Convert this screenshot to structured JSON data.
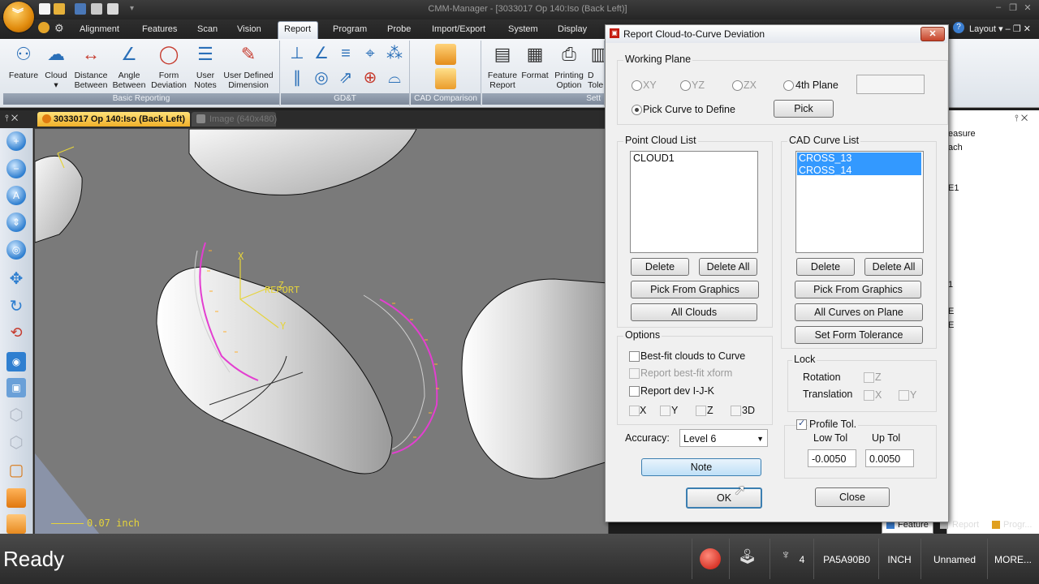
{
  "app": {
    "title": "CMM-Manager - [3033017 Op 140:Iso (Back Left)]",
    "layout_menu": "Layout",
    "window_min": "–",
    "window_restore": "❐",
    "window_close": "✕"
  },
  "tabs": [
    "Alignment",
    "Features",
    "Scan",
    "Vision",
    "Report",
    "Program",
    "Probe",
    "Import/Export",
    "System",
    "Display"
  ],
  "ribbon": {
    "basic_reporting": {
      "label": "Basic Reporting",
      "items": [
        {
          "line1": "Feature",
          "line2": ""
        },
        {
          "line1": "Cloud",
          "line2": "▾"
        },
        {
          "line1": "Distance",
          "line2": "Between"
        },
        {
          "line1": "Angle",
          "line2": "Between"
        },
        {
          "line1": "Form",
          "line2": "Deviation"
        },
        {
          "line1": "User",
          "line2": "Notes"
        },
        {
          "line1": "User Defined",
          "line2": "Dimension"
        }
      ]
    },
    "gdt": {
      "label": "GD&T"
    },
    "cad_comparison": {
      "label": "CAD Comparison"
    },
    "report_group": {
      "label": "Sett",
      "items": [
        {
          "line1": "Feature",
          "line2": "Report"
        },
        {
          "line1": "Format",
          "line2": ""
        },
        {
          "line1": "Printing",
          "line2": "Option"
        },
        {
          "line1": "D",
          "line2": "Tole"
        }
      ]
    }
  },
  "doc_tabs": {
    "active": "3033017 Op 140:Iso (Back Left)",
    "inactive": "Image (640x480)"
  },
  "viewport": {
    "report_label": "REPORT",
    "axis_x": "X",
    "axis_y": "Y",
    "axis_z": "Z",
    "scale_label": "0.07 inch"
  },
  "right_panel": {
    "items": [
      "easure",
      "ach",
      "E1",
      "1",
      "E",
      "E"
    ],
    "tabs": [
      "Feature",
      "Report",
      "Progr..."
    ]
  },
  "status": {
    "ready": "Ready",
    "count": "4",
    "probe": "PA5A90B0",
    "units": "INCH",
    "file": "Unnamed",
    "more": "MORE..."
  },
  "dialog": {
    "title": "Report Cloud-to-Curve Deviation",
    "working_plane": {
      "label": "Working Plane",
      "options": [
        "XY",
        "YZ",
        "ZX",
        "4th Plane"
      ],
      "pick_curve": "Pick Curve to Define",
      "pick_button": "Pick",
      "fourth_plane_value": ""
    },
    "point_cloud": {
      "label": "Point Cloud List",
      "items": [
        "CLOUD1"
      ],
      "delete": "Delete",
      "delete_all": "Delete All",
      "pick_from_graphics": "Pick From Graphics",
      "all": "All Clouds"
    },
    "cad_curve": {
      "label": "CAD Curve List",
      "items": [
        "CROSS_13",
        "CROSS_14"
      ],
      "delete": "Delete",
      "delete_all": "Delete All",
      "pick_from_graphics": "Pick From Graphics",
      "all": "All Curves on Plane",
      "set_tolerance": "Set Form Tolerance"
    },
    "options": {
      "label": "Options",
      "bestfit": "Best-fit clouds to Curve",
      "report_bestfit": "Report best-fit xform",
      "report_dev": "Report dev I-J-K",
      "x": "X",
      "y": "Y",
      "z": "Z",
      "three_d": "3D"
    },
    "lock": {
      "label": "Lock",
      "rotation": "Rotation",
      "translation": "Translation",
      "z": "Z",
      "x": "X",
      "y": "Y"
    },
    "accuracy": {
      "label": "Accuracy:",
      "value": "Level 6"
    },
    "profile_tol": {
      "label": "Profile Tol.",
      "low_label": "Low Tol",
      "up_label": "Up Tol",
      "low": "-0.0050",
      "up": "0.0050"
    },
    "note": "Note",
    "ok": "OK",
    "close": "Close"
  }
}
